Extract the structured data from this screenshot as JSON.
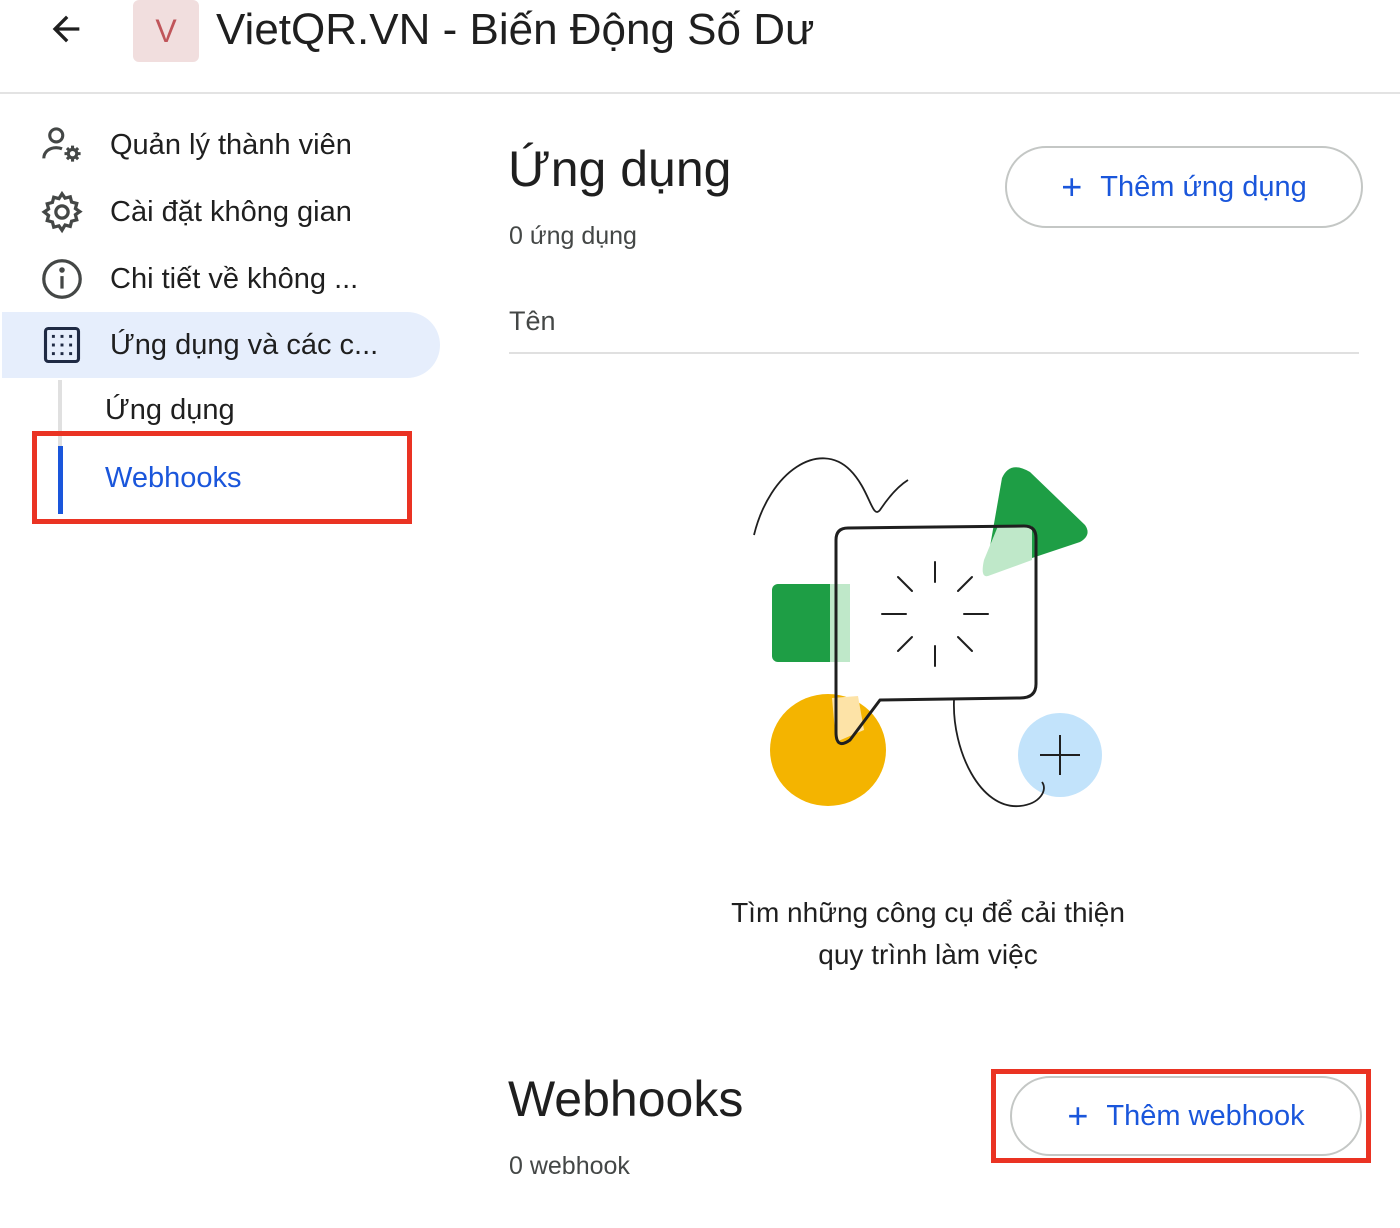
{
  "header": {
    "back_icon": "arrow-left-icon",
    "avatar_letter": "V",
    "title": "VietQR.VN - Biến Động Số Dư"
  },
  "sidebar": {
    "items": [
      {
        "label": "Quản lý thành viên",
        "icon": "manage-members-icon"
      },
      {
        "label": "Cài đặt không gian",
        "icon": "settings-gear-icon"
      },
      {
        "label": "Chi tiết về không ...",
        "icon": "info-icon"
      },
      {
        "label": "Ứng dụng và các c...",
        "icon": "apps-grid-icon",
        "active": true
      }
    ],
    "sub_items": [
      {
        "label": "Ứng dụng"
      },
      {
        "label": "Webhooks",
        "active": true
      }
    ]
  },
  "apps_section": {
    "title": "Ứng dụng",
    "count": "0 ứng dụng",
    "add_button": "Thêm ứng dụng",
    "column_name": "Tên",
    "empty_line1": "Tìm những công cụ để cải thiện",
    "empty_line2": "quy trình làm việc"
  },
  "webhooks_section": {
    "title": "Webhooks",
    "count": "0 webhook",
    "add_button": "Thêm webhook"
  },
  "colors": {
    "accent": "#1a56db",
    "highlight": "#ea3323",
    "active_bg": "#e6eefc"
  }
}
